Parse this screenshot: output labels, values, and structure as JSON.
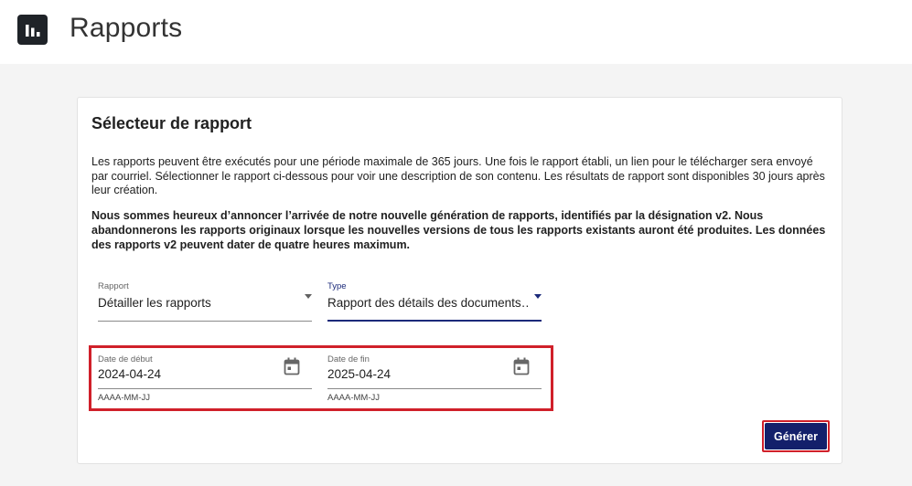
{
  "header": {
    "title": "Rapports",
    "logo_icon": "bar-chart-icon"
  },
  "card": {
    "title": "Sélecteur de rapport",
    "description": "Les rapports peuvent être exécutés pour une période maximale de 365 jours. Une fois le rapport établi, un lien pour le télécharger sera envoyé par courriel. Sélectionner le rapport ci-dessous pour voir une description de son contenu. Les résultats de rapport sont disponibles 30 jours après leur création.",
    "announcement": "Nous sommes heureux d’annoncer l’arrivée de notre nouvelle génération de rapports, identifiés par la désignation v2. Nous abandonnerons les rapports originaux lorsque les nouvelles versions de tous les rapports existants auront été produites. Les données des rapports v2 peuvent dater de quatre heures maximum."
  },
  "form": {
    "report": {
      "label": "Rapport",
      "value": "Détailler les rapports"
    },
    "type": {
      "label": "Type",
      "value": "Rapport des détails des documents…"
    },
    "start_date": {
      "label": "Date de début",
      "value": "2024-04-24",
      "hint": "AAAA-MM-JJ"
    },
    "end_date": {
      "label": "Date de fin",
      "value": "2025-04-24",
      "hint": "AAAA-MM-JJ"
    },
    "generate_label": "Générer"
  },
  "colors": {
    "accent": "#13206b",
    "highlight": "#d0202a"
  }
}
